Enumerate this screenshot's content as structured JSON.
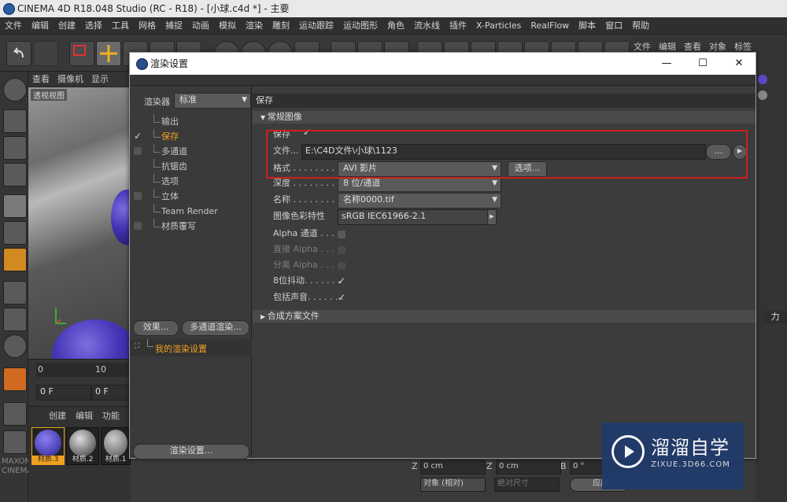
{
  "window": {
    "title": "CINEMA 4D R18.048 Studio (RC - R18) - [小球.c4d *] - 主要"
  },
  "menu": [
    "文件",
    "编辑",
    "创建",
    "选择",
    "工具",
    "网格",
    "捕捉",
    "动画",
    "模拟",
    "渲染",
    "雕刻",
    "运动跟踪",
    "运动图形",
    "角色",
    "流水线",
    "插件",
    "X-Particles",
    "RealFlow",
    "脚本",
    "窗口",
    "帮助"
  ],
  "right_tabs": [
    "文件",
    "编辑",
    "查看",
    "对象",
    "标签"
  ],
  "viewport": {
    "menu": [
      "查看",
      "摄像机",
      "显示"
    ],
    "label": "透视视图"
  },
  "timeline": {
    "tick0": "0",
    "tick10": "10",
    "frame_field": "0 F",
    "frame_field2": "0 F"
  },
  "materials": {
    "menu": [
      "创建",
      "编辑",
      "功能"
    ],
    "items": [
      "材质.3",
      "材质.2",
      "材质.1"
    ]
  },
  "coords": {
    "z1": "0 cm",
    "z2": "0 cm",
    "b": "0 °",
    "mode": "对象 (相对)",
    "size_mode": "绝对尺寸",
    "apply": "应用",
    "z_label": "Z",
    "b_label": "B"
  },
  "right_extra": {
    "force": "力"
  },
  "dialog": {
    "title": "渲染设置",
    "renderer_label": "渲染器",
    "renderer_value": "标准",
    "tree": [
      {
        "label": "输出",
        "check": "none"
      },
      {
        "label": "保存",
        "check": "checked",
        "active": true
      },
      {
        "label": "多通道",
        "check": "box"
      },
      {
        "label": "抗锯齿",
        "check": "none"
      },
      {
        "label": "选项",
        "check": "none"
      },
      {
        "label": "立体",
        "check": "box"
      },
      {
        "label": "Team Render",
        "check": "none"
      },
      {
        "label": "材质覆写",
        "check": "box"
      }
    ],
    "btn_effects": "效果...",
    "btn_multipass": "多通道渲染...",
    "render_setting_item": "我的渲染设置",
    "btn_render_settings": "渲染设置...",
    "section_title": "保存",
    "group_regular": "常规图像",
    "group_composite": "合成方案文件",
    "rows": {
      "save": {
        "label": "保存"
      },
      "file": {
        "label": "文件...",
        "value": "E:\\C4D文件\\小球\\1123",
        "btn": "..."
      },
      "format": {
        "label": "格式 . . . . . . . . .",
        "value": "AVI 影片",
        "btn": "选项..."
      },
      "depth": {
        "label": "深度 . . . . . . . . .",
        "value": "8 位/通道"
      },
      "name": {
        "label": "名称 . . . . . . . . .",
        "value": "名称0000.tif"
      },
      "profile": {
        "label": "图像色彩特性",
        "value": "sRGB IEC61966-2.1"
      },
      "alpha": {
        "label": "Alpha 通道 . . . . ."
      },
      "straight_alpha": {
        "label": "直接 Alpha . . . . ."
      },
      "separate_alpha": {
        "label": "分离 Alpha . . . . ."
      },
      "dither": {
        "label": "8位抖动. . . . . . ."
      },
      "sound": {
        "label": "包括声音. . . . . . ."
      }
    }
  },
  "watermark": {
    "title": "溜溜自学",
    "url": "ZIXUE.3D66.COM"
  },
  "colors": {
    "accent_orange": "#f0a020",
    "red_highlight": "#d21e1e"
  }
}
